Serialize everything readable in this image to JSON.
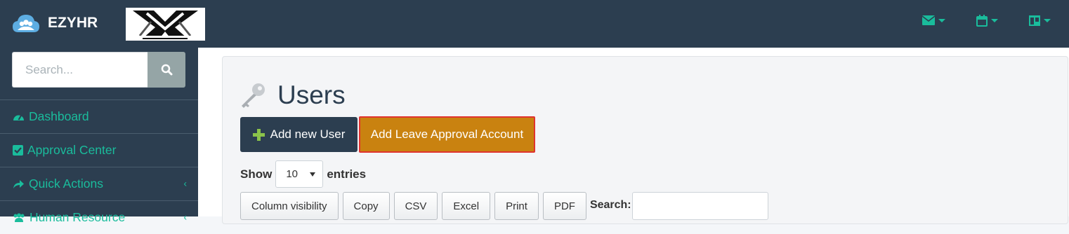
{
  "app": {
    "brand": "EZYHR",
    "logo_name": "monsta-x-logo",
    "logo_text": "monsta X"
  },
  "topbar": {
    "icons": [
      "envelope-icon",
      "calendar-icon",
      "columns-icon"
    ]
  },
  "sidebar": {
    "search": {
      "placeholder": "Search...",
      "value": ""
    },
    "items": [
      {
        "label": "Dashboard",
        "icon": "dashboard-icon",
        "has_submenu": false
      },
      {
        "label": "Approval Center",
        "icon": "check-square-icon",
        "has_submenu": false
      },
      {
        "label": "Quick Actions",
        "icon": "share-icon",
        "has_submenu": true
      },
      {
        "label": "Human Resource",
        "icon": "users-icon",
        "has_submenu": true
      }
    ]
  },
  "page": {
    "title": "Users",
    "title_icon": "key-icon",
    "add_user_label": "Add new User",
    "add_leave_label": "Add Leave Approval Account"
  },
  "table_controls": {
    "show_label": "Show",
    "entries_value": "10",
    "entries_label": "entries",
    "buttons": [
      "Column visibility",
      "Copy",
      "CSV",
      "Excel",
      "Print",
      "PDF"
    ],
    "search_label": "Search:",
    "search_value": ""
  },
  "colors": {
    "navbar": "#2c3e50",
    "accent": "#1abc9c",
    "warning_button": "#c98210",
    "highlight_border": "#e0332f"
  }
}
